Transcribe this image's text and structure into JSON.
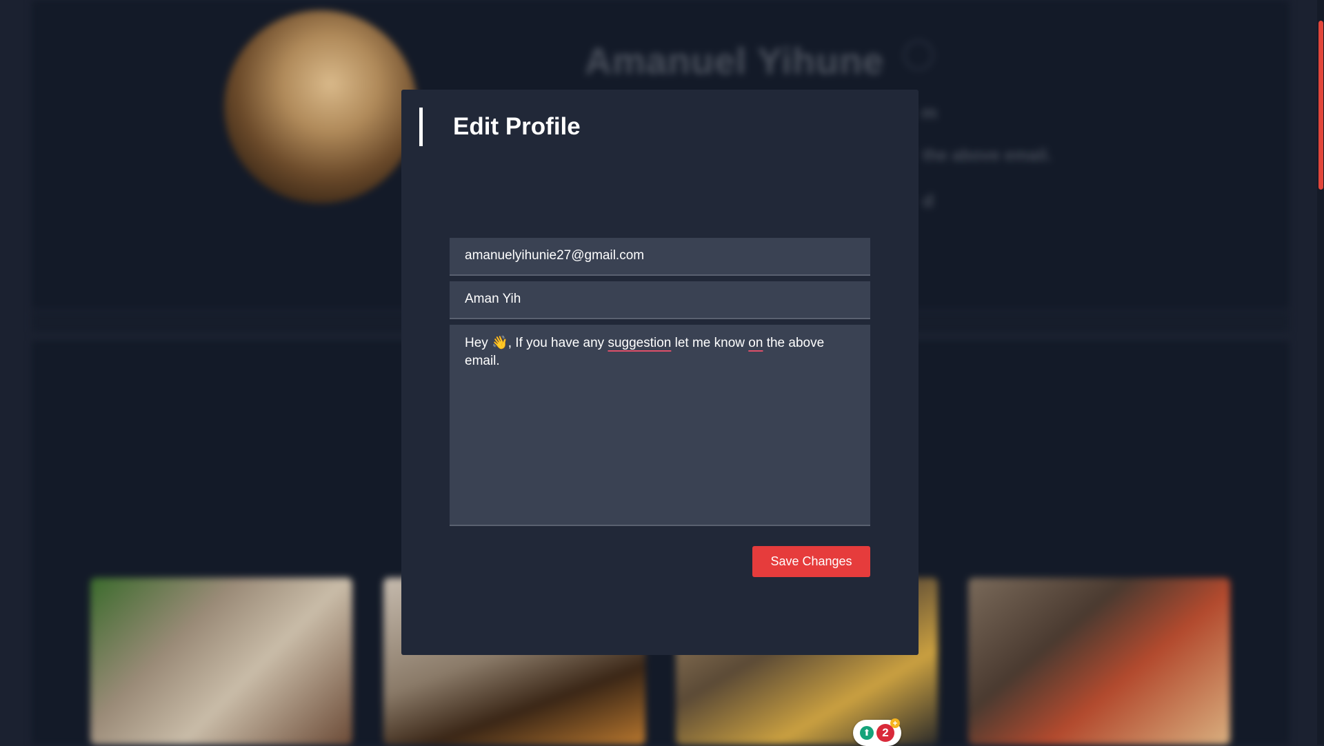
{
  "background": {
    "profile_name": "Amanuel Yihune",
    "partial_lines": [
      "m",
      "the above email.",
      "d"
    ]
  },
  "modal": {
    "title": "Edit Profile",
    "email_value": "amanuelyihunie27@gmail.com",
    "name_value": "Aman Yih",
    "bio": {
      "part1": "Hey ",
      "emoji": "👋",
      "part2": ", If you have any ",
      "flag1": "suggestion",
      "part3": " let me know ",
      "flag2": "on",
      "part4": " the above email."
    },
    "grammar_widget": {
      "count": "2",
      "plus": "+",
      "bulb": "⬆"
    },
    "save_label": "Save Changes"
  },
  "colors": {
    "accent": "#e63c3c",
    "modal_bg": "#212838",
    "field_bg": "#3a4253",
    "page_bg": "#1b2130"
  }
}
